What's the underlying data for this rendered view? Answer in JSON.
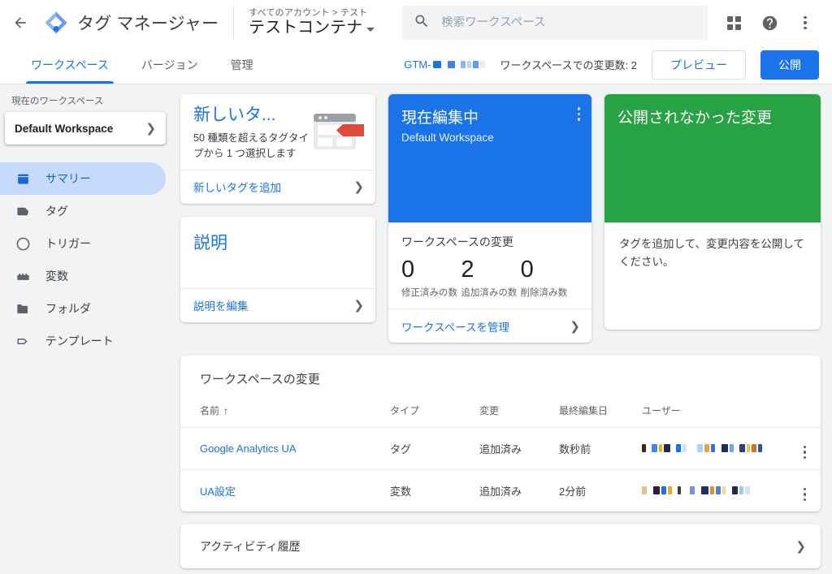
{
  "header": {
    "back_icon": "back-arrow-icon",
    "logo_icon": "tag-manager-logo-icon",
    "product_name": "タグ マネージャー",
    "breadcrumbs": "すべてのアカウント > テスト",
    "container_name": "テストコンテナ",
    "search_placeholder": "検索ワークスペース",
    "search_value": "",
    "search_icon": "search-icon",
    "apps_icon": "apps-grid-icon",
    "help_icon": "help-icon",
    "more_icon": "more-vertical-icon"
  },
  "tabbar": {
    "tabs": [
      {
        "label": "ワークスペース",
        "active": true
      },
      {
        "label": "バージョン",
        "active": false
      },
      {
        "label": "管理",
        "active": false
      }
    ],
    "gtm_id_prefix": "GTM-",
    "gtm_id_redacted": true,
    "changes_count_label": "ワークスペースでの変更数: 2",
    "preview_label": "プレビュー",
    "publish_label": "公開"
  },
  "sidebar": {
    "current_workspace_label": "現在のワークスペース",
    "workspace_name": "Default Workspace",
    "workspace_chevron": "chevron-right-icon",
    "items": [
      {
        "label": "サマリー",
        "icon": "summary-icon",
        "active": true
      },
      {
        "label": "タグ",
        "icon": "tag-icon",
        "active": false
      },
      {
        "label": "トリガー",
        "icon": "trigger-icon",
        "active": false
      },
      {
        "label": "変数",
        "icon": "variable-icon",
        "active": false
      },
      {
        "label": "フォルダ",
        "icon": "folder-icon",
        "active": false
      },
      {
        "label": "テンプレート",
        "icon": "template-icon",
        "active": false
      }
    ]
  },
  "new_tag_card": {
    "title": "新しいタ...",
    "description": "50 種類を超えるタグタイプから 1 つ選択します",
    "action_label": "新しいタグを追加",
    "action_chevron": "chevron-right-icon",
    "illustration_icon": "browser-tag-illustration-icon"
  },
  "description_card": {
    "title": "説明",
    "action_label": "説明を編集",
    "action_chevron": "chevron-right-icon"
  },
  "editing_card": {
    "title": "現在編集中",
    "subtitle": "Default Workspace",
    "menu_icon": "more-vertical-icon",
    "stats_title": "ワークスペースの変更",
    "stats": [
      {
        "value": "0",
        "label": "修正済みの数"
      },
      {
        "value": "2",
        "label": "追加済みの数"
      },
      {
        "value": "0",
        "label": "削除済み数"
      }
    ],
    "action_label": "ワークスペースを管理",
    "action_chevron": "chevron-right-icon",
    "accent_color": "#1a73e8"
  },
  "unpublished_card": {
    "title": "公開されなかった変更",
    "body": "タグを追加して、変更内容を公開してください。",
    "accent_color": "#27a343"
  },
  "changes_table": {
    "title": "ワークスペースの変更",
    "columns": [
      "名前",
      "タイプ",
      "変更",
      "最終編集日",
      "ユーザー"
    ],
    "sort_column": "名前",
    "sort_arrow": "↑",
    "rows": [
      {
        "name": "Google Analytics UA",
        "type": "タグ",
        "change": "追加済み",
        "last_edited": "数秒前",
        "user_redacted": true,
        "menu_icon": "more-vertical-icon"
      },
      {
        "name": "UA設定",
        "type": "変数",
        "change": "追加済み",
        "last_edited": "2分前",
        "user_redacted": true,
        "menu_icon": "more-vertical-icon"
      }
    ]
  },
  "activity_card": {
    "title": "アクティビティ履歴",
    "chevron": "chevron-right-icon"
  }
}
